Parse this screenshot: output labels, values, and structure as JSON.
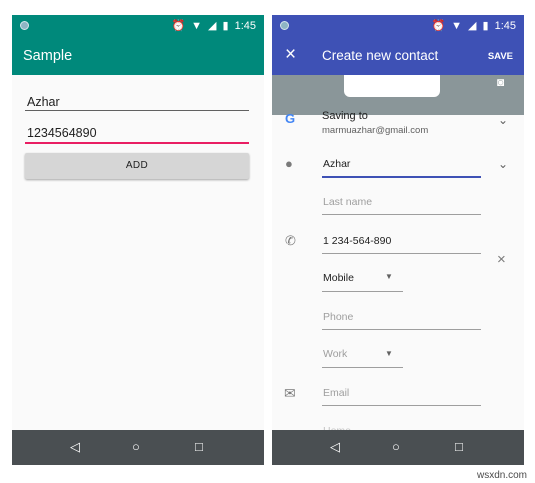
{
  "left_phone": {
    "status_time": "1:45",
    "app_title": "Sample",
    "name_value": "Azhar",
    "phone_value": "1234564890",
    "add_button": "ADD",
    "accent_color": "#00897b"
  },
  "right_phone": {
    "status_time": "1:45",
    "title": "Create new contact",
    "save_label": "SAVE",
    "saving_to_label": "Saving to",
    "account_email": "marmuazhar@gmail.com",
    "first_name": "Azhar",
    "last_name_placeholder": "Last name",
    "phone_value": "1 234-564-890",
    "phone_type": "Mobile",
    "phone_placeholder": "Phone",
    "work_type": "Work",
    "email_placeholder": "Email",
    "partial_type": "Home",
    "accent_color": "#3e51b5"
  },
  "watermark": "wsxdn.com"
}
